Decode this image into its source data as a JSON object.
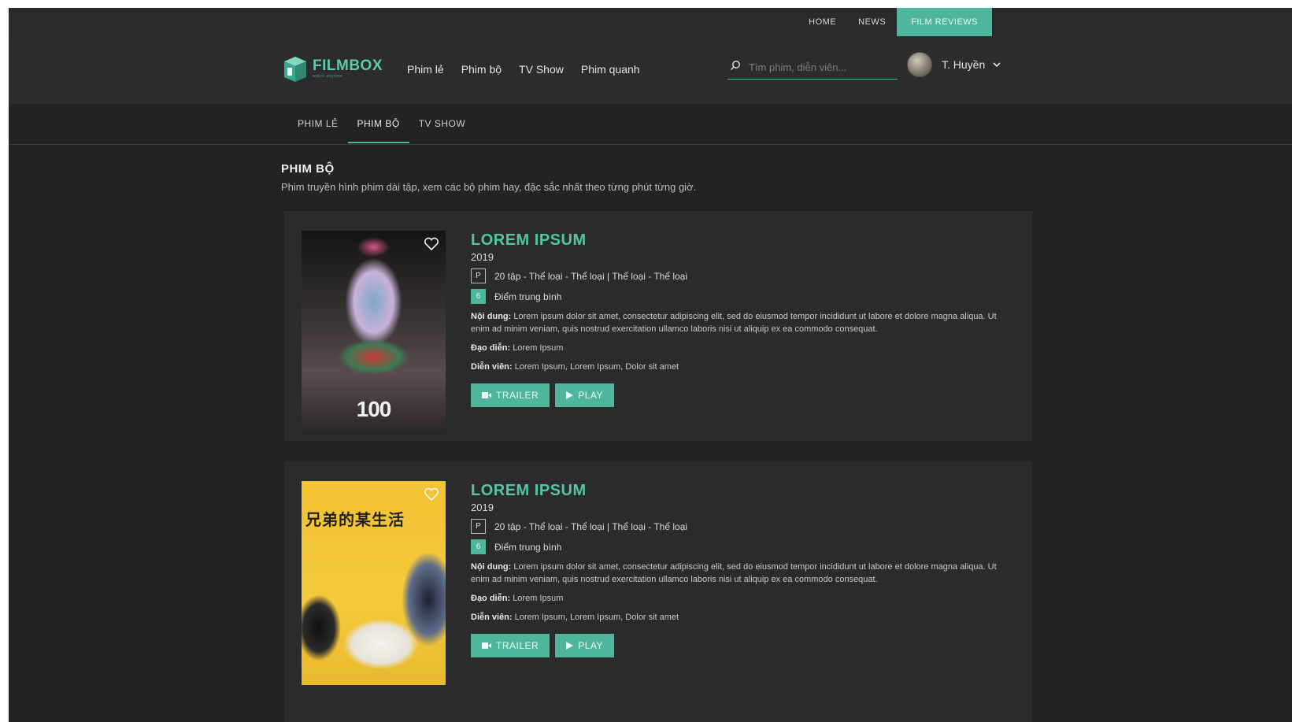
{
  "top_links": [
    {
      "label": "Home",
      "active": false
    },
    {
      "label": "News",
      "active": false
    },
    {
      "label": "Film reviews",
      "active": true
    }
  ],
  "brand": {
    "name": "FILMBOX",
    "tagline": "watch anytime",
    "accent": "#4fb59d"
  },
  "nav": [
    {
      "label": "Phim lẻ"
    },
    {
      "label": "Phim bộ"
    },
    {
      "label": "TV Show"
    },
    {
      "label": "Phim quanh"
    }
  ],
  "search": {
    "placeholder": "Tìm phim, diễn viên..."
  },
  "user": {
    "name": "T. Huyền"
  },
  "tabs": [
    {
      "label": "PHIM LẺ",
      "active": false
    },
    {
      "label": "PHIM BỘ",
      "active": true
    },
    {
      "label": "TV SHOW",
      "active": false
    }
  ],
  "section": {
    "title": "PHIM BỘ",
    "description": "Phim truyền hình phim dài tập, xem các bộ phim hay, đặc sắc nhất theo từng phút từng giờ."
  },
  "movies": [
    {
      "title": "LOREM IPSUM",
      "year": "2019",
      "rating_badge": "P",
      "meta": "20 tập - Thể loại - Thể loại | Thể loại - Thể loại",
      "score": "6",
      "score_label": "Điểm trung bình",
      "content_label": "Nội dung:",
      "content": "Lorem ipsum dolor sit amet, consectetur adipiscing elit, sed do eiusmod tempor incididunt ut labore et dolore magna aliqua. Ut enim ad minim veniam, quis nostrud exercitation ullamco laboris nisi ut aliquip ex ea commodo consequat.",
      "director_label": "Đạo diễn:",
      "director": "Lorem Ipsum",
      "cast_label": "Diễn viên:",
      "cast": "Lorem Ipsum, Lorem Ipsum, Dolor sit amet",
      "poster_caption": "100",
      "trailer_label": "TRAILER",
      "play_label": "PLAY"
    },
    {
      "title": "LOREM IPSUM",
      "year": "2019",
      "rating_badge": "P",
      "meta": "20 tập - Thể loại - Thể loại | Thể loại - Thể loại",
      "score": "6",
      "score_label": "Điểm trung bình",
      "content_label": "Nội dung:",
      "content": "Lorem ipsum dolor sit amet, consectetur adipiscing elit, sed do eiusmod tempor incididunt ut labore et dolore magna aliqua. Ut enim ad minim veniam, quis nostrud exercitation ullamco laboris nisi ut aliquip ex ea commodo consequat.",
      "director_label": "Đạo diễn:",
      "director": "Lorem Ipsum",
      "cast_label": "Diễn viên:",
      "cast": "Lorem Ipsum, Lorem Ipsum, Dolor sit amet",
      "poster_caption": "兄弟的某生活",
      "trailer_label": "TRAILER",
      "play_label": "PLAY"
    }
  ]
}
